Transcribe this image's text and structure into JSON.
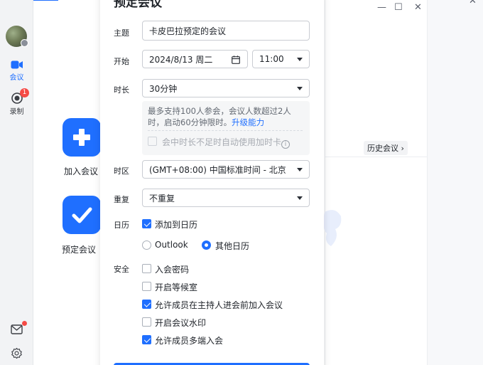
{
  "colors": {
    "accent": "#1f6fff",
    "badge": "#f54a45"
  },
  "rail": {
    "meet_label": "会议",
    "record_label": "录制",
    "record_badge": "1"
  },
  "window_controls": [
    "—",
    "☐",
    "✕"
  ],
  "home": {
    "join_label": "加入会议",
    "schedule_label": "预定会议",
    "history_label": "历史会议 ›"
  },
  "dialog": {
    "title": "预定会议",
    "topic_label": "主题",
    "topic_value": "卡皮巴拉预定的会议",
    "start_label": "开始",
    "start_date": "2024/8/13 周二",
    "start_time": "11:00",
    "duration_label": "时长",
    "duration_value": "30分钟",
    "info_text": "最多支持100人参会，会议人数超过2人时，启动60分钟限时。",
    "info_link": "升级能力",
    "overtime_label": "会中时长不足时自动使用加时卡",
    "overtime_checked": false,
    "timezone_label": "时区",
    "timezone_value": "(GMT+08:00) 中国标准时间 - 北京",
    "repeat_label": "重复",
    "repeat_value": "不重复",
    "calendar_label": "日历",
    "add_calendar_label": "添加到日历",
    "add_calendar_checked": true,
    "calendar_options": [
      {
        "label": "Outlook",
        "selected": false
      },
      {
        "label": "其他日历",
        "selected": true
      }
    ],
    "security_label": "安全",
    "security_options": [
      {
        "label": "入会密码",
        "checked": false
      },
      {
        "label": "开启等候室",
        "checked": false
      },
      {
        "label": "允许成员在主持人进会前加入会议",
        "checked": true
      },
      {
        "label": "开启会议水印",
        "checked": false
      },
      {
        "label": "允许成员多端入会",
        "checked": true
      }
    ]
  }
}
